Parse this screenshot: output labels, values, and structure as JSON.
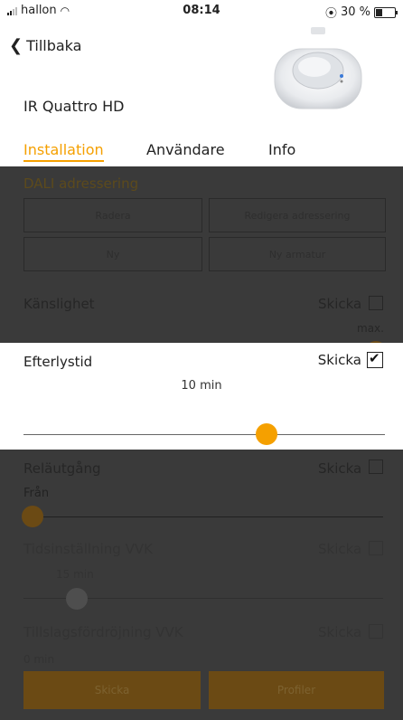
{
  "status_bar": {
    "carrier": "hallon",
    "time": "08:14",
    "battery": "30 %"
  },
  "nav": {
    "back_label": "Tillbaka"
  },
  "device": {
    "name": "IR Quattro HD"
  },
  "tabs": [
    {
      "label": "Installation",
      "active": true
    },
    {
      "label": "Användare",
      "active": false
    },
    {
      "label": "Info",
      "active": false
    }
  ],
  "dali": {
    "title": "DALI adressering",
    "buttons": {
      "clear": "Radera",
      "edit": "Redigera adressering",
      "new": "Ny",
      "new_fixture": "Ny armatur"
    }
  },
  "sensitivity": {
    "label": "Känslighet",
    "send": "Skicka",
    "value": "max."
  },
  "afterlight": {
    "label": "Efterlystid",
    "send": "Skicka",
    "value": "10 min",
    "checked": true
  },
  "relay": {
    "label": "Reläutgång",
    "send": "Skicka",
    "value": "Från"
  },
  "hvac_time": {
    "label": "Tidsinställning VVK",
    "send": "Skicka",
    "value": "15 min"
  },
  "hvac_delay": {
    "label": "Tillslagsfördröjning VVK",
    "send": "Skicka",
    "value": "0 min"
  },
  "footer": {
    "send": "Skicka",
    "profiles": "Profiler"
  },
  "colors": {
    "accent": "#f5a000",
    "overlay": "#3a3a3a"
  }
}
